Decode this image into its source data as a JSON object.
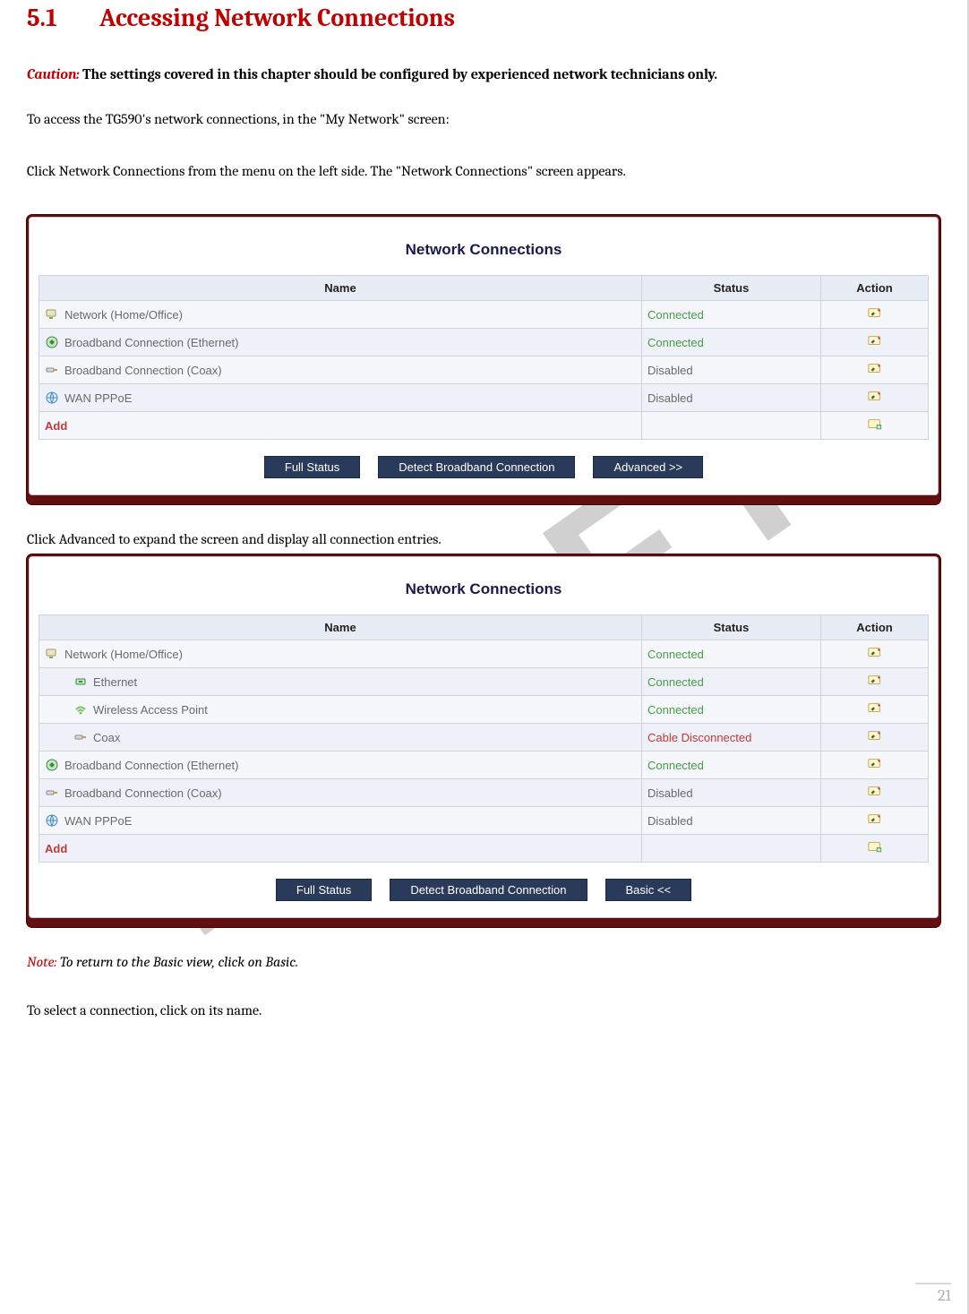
{
  "watermark": "DRAFT",
  "page_number": "21",
  "heading": {
    "number": "5.1",
    "title": "Accessing Network Connections"
  },
  "caution": {
    "label": "Caution:",
    "text": "The settings covered in this chapter should be configured by experienced network technicians only."
  },
  "body": {
    "line1": "To access the TG590's network connections, in the \"My Network\" screen:",
    "line2": "Click Network Connections from the menu on the left side. The \"Network Connections\" screen appears.",
    "line3": "Click Advanced to expand the screen and display all connection entries.",
    "line4": "To select a connection, click on its name."
  },
  "note": {
    "label": "Note:",
    "text": "To return to the Basic view, click on Basic."
  },
  "panel_title": "Network Connections",
  "table": {
    "headers": {
      "name": "Name",
      "status": "Status",
      "action": "Action"
    },
    "add_label": "Add"
  },
  "buttons": {
    "full_status": "Full Status",
    "detect": "Detect Broadband Connection",
    "advanced": "Advanced >>",
    "basic": "Basic <<"
  },
  "basic_rows": [
    {
      "icon": "network-icon",
      "name": "Network (Home/Office)",
      "status": "Connected",
      "status_class": "connected",
      "indent": 0,
      "action": "edit"
    },
    {
      "icon": "ethernet-icon",
      "name": "Broadband Connection (Ethernet)",
      "status": "Connected",
      "status_class": "connected",
      "indent": 0,
      "action": "edit"
    },
    {
      "icon": "coax-icon",
      "name": "Broadband Connection (Coax)",
      "status": "Disabled",
      "status_class": "disabled",
      "indent": 0,
      "action": "edit"
    },
    {
      "icon": "wan-icon",
      "name": "WAN PPPoE",
      "status": "Disabled",
      "status_class": "disabled",
      "indent": 0,
      "action": "edit"
    }
  ],
  "advanced_rows": [
    {
      "icon": "network-icon",
      "name": "Network (Home/Office)",
      "status": "Connected",
      "status_class": "connected",
      "indent": 0,
      "action": "edit"
    },
    {
      "icon": "ethernet-sub-icon",
      "name": "Ethernet",
      "status": "Connected",
      "status_class": "connected",
      "indent": 1,
      "action": "edit"
    },
    {
      "icon": "wifi-icon",
      "name": "Wireless Access Point",
      "status": "Connected",
      "status_class": "connected",
      "indent": 1,
      "action": "edit"
    },
    {
      "icon": "coax-icon",
      "name": "Coax",
      "status": "Cable Disconnected",
      "status_class": "error",
      "indent": 1,
      "action": "edit"
    },
    {
      "icon": "ethernet-icon",
      "name": "Broadband Connection (Ethernet)",
      "status": "Connected",
      "status_class": "connected",
      "indent": 0,
      "action": "edit"
    },
    {
      "icon": "coax-icon",
      "name": "Broadband Connection (Coax)",
      "status": "Disabled",
      "status_class": "disabled",
      "indent": 0,
      "action": "edit"
    },
    {
      "icon": "wan-icon",
      "name": "WAN PPPoE",
      "status": "Disabled",
      "status_class": "disabled",
      "indent": 0,
      "action": "edit"
    }
  ]
}
